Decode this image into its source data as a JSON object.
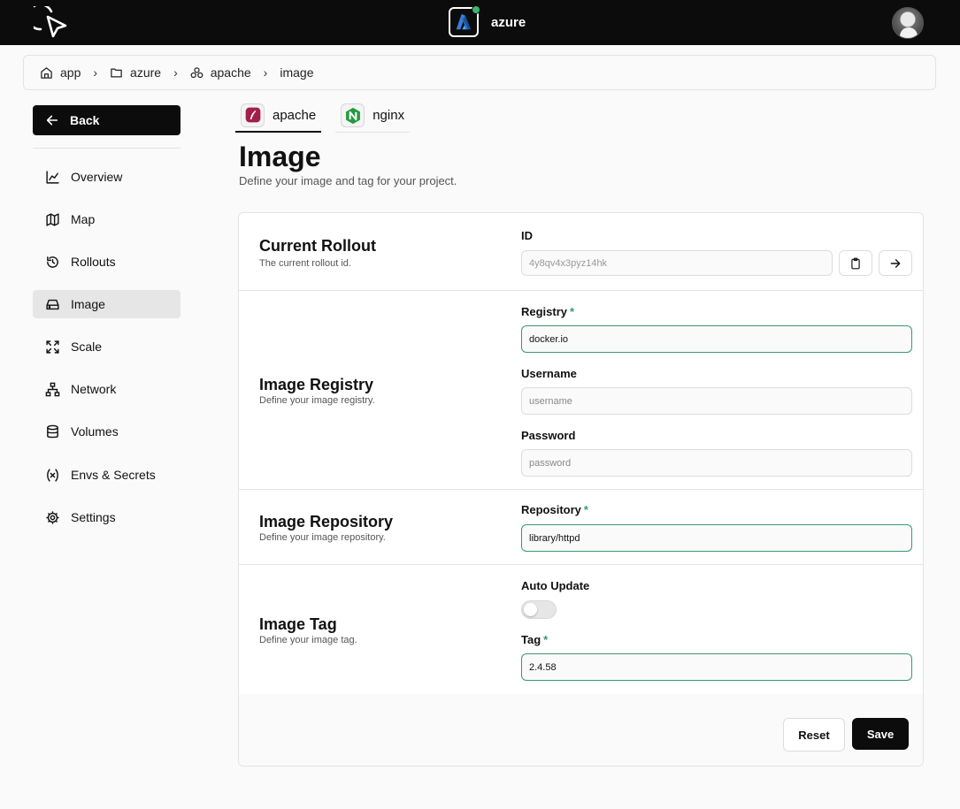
{
  "header": {
    "project_name": "azure",
    "status_color": "#3cb371"
  },
  "breadcrumb": [
    {
      "label": "app",
      "icon": "home-icon"
    },
    {
      "label": "azure",
      "icon": "folder-icon"
    },
    {
      "label": "apache",
      "icon": "cluster-icon"
    },
    {
      "label": "image",
      "icon": ""
    }
  ],
  "sidebar": {
    "back_label": "Back",
    "items": [
      {
        "label": "Overview",
        "icon": "chart-line-icon"
      },
      {
        "label": "Map",
        "icon": "map-icon"
      },
      {
        "label": "Rollouts",
        "icon": "history-icon"
      },
      {
        "label": "Image",
        "icon": "drive-icon",
        "active": true
      },
      {
        "label": "Scale",
        "icon": "expand-icon"
      },
      {
        "label": "Network",
        "icon": "network-icon"
      },
      {
        "label": "Volumes",
        "icon": "database-icon"
      },
      {
        "label": "Envs & Secrets",
        "icon": "variable-icon"
      },
      {
        "label": "Settings",
        "icon": "gear-icon"
      }
    ]
  },
  "tabs": [
    {
      "label": "apache",
      "icon": "apache-icon",
      "active": true
    },
    {
      "label": "nginx",
      "icon": "nginx-icon",
      "active": false
    }
  ],
  "page": {
    "title": "Image",
    "subtitle": "Define your image and tag for your project."
  },
  "sections": {
    "rollout": {
      "title": "Current Rollout",
      "desc": "The current rollout id.",
      "id_label": "ID",
      "id_value": "4y8qv4x3pyz14hk"
    },
    "registry": {
      "title": "Image Registry",
      "desc": "Define your image registry.",
      "registry_label": "Registry",
      "registry_value": "docker.io",
      "username_label": "Username",
      "username_placeholder": "username",
      "password_label": "Password",
      "password_placeholder": "password"
    },
    "repository": {
      "title": "Image Repository",
      "desc": "Define your image repository.",
      "repo_label": "Repository",
      "repo_value": "library/httpd"
    },
    "tag": {
      "title": "Image Tag",
      "desc": "Define your image tag.",
      "auto_update_label": "Auto Update",
      "auto_update_on": false,
      "tag_label": "Tag",
      "tag_value": "2.4.58"
    }
  },
  "required_mark": "*",
  "actions": {
    "reset_label": "Reset",
    "save_label": "Save"
  },
  "colors": {
    "accent_valid": "#3a9a6a",
    "primary_dark": "#0c0c0c"
  }
}
